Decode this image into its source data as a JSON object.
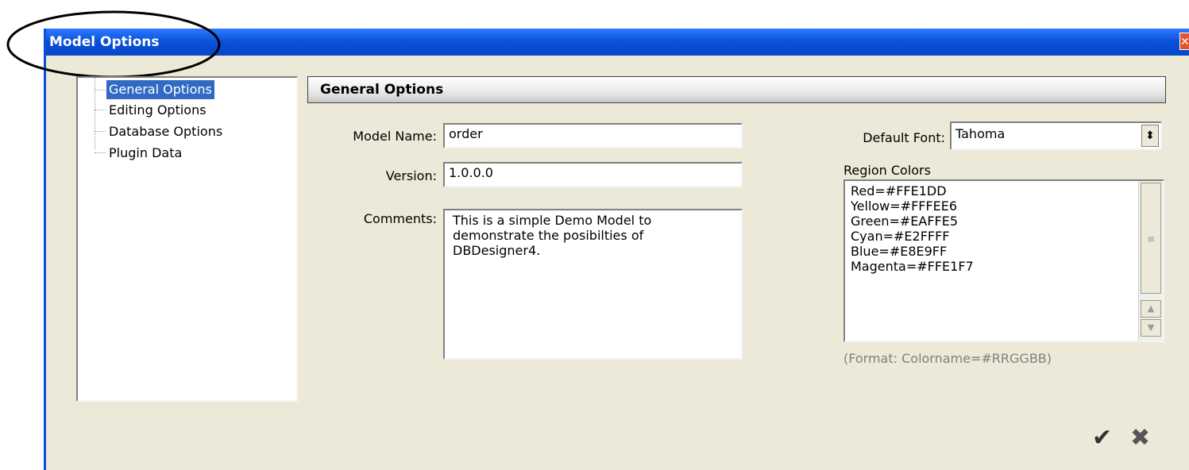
{
  "window": {
    "title": "Model Options",
    "close_icon": "close-icon"
  },
  "sidebar": {
    "items": [
      {
        "label": "General Options"
      },
      {
        "label": "Editing Options"
      },
      {
        "label": "Database Options"
      },
      {
        "label": "Plugin Data"
      }
    ],
    "selected": "General Options"
  },
  "main": {
    "header": "General Options",
    "model_name": {
      "label": "Model Name:",
      "value": "order"
    },
    "version": {
      "label": "Version:",
      "value": "1.0.0.0"
    },
    "comments": {
      "label": "Comments:",
      "value": "This is a simple Demo Model to\ndemonstrate the posibilties of\nDBDesigner4."
    },
    "default_font": {
      "label": "Default Font:",
      "value": "Tahoma"
    },
    "region_colors": {
      "label": "Region Colors",
      "items": [
        "Red=#FFE1DD",
        "Yellow=#FFFEE6",
        "Green=#EAFFE5",
        "Cyan=#E2FFFF",
        "Blue=#E8E9FF",
        "Magenta=#FFE1F7"
      ],
      "hint": "(Format: Colorname=#RRGGBB)"
    }
  },
  "footer": {
    "ok_icon": "checkmark-icon",
    "cancel_icon": "x-icon"
  },
  "colors": {
    "titlebar": "#0a4fd8",
    "selection": "#316ac5",
    "dialog_bg": "#ece9d8"
  }
}
